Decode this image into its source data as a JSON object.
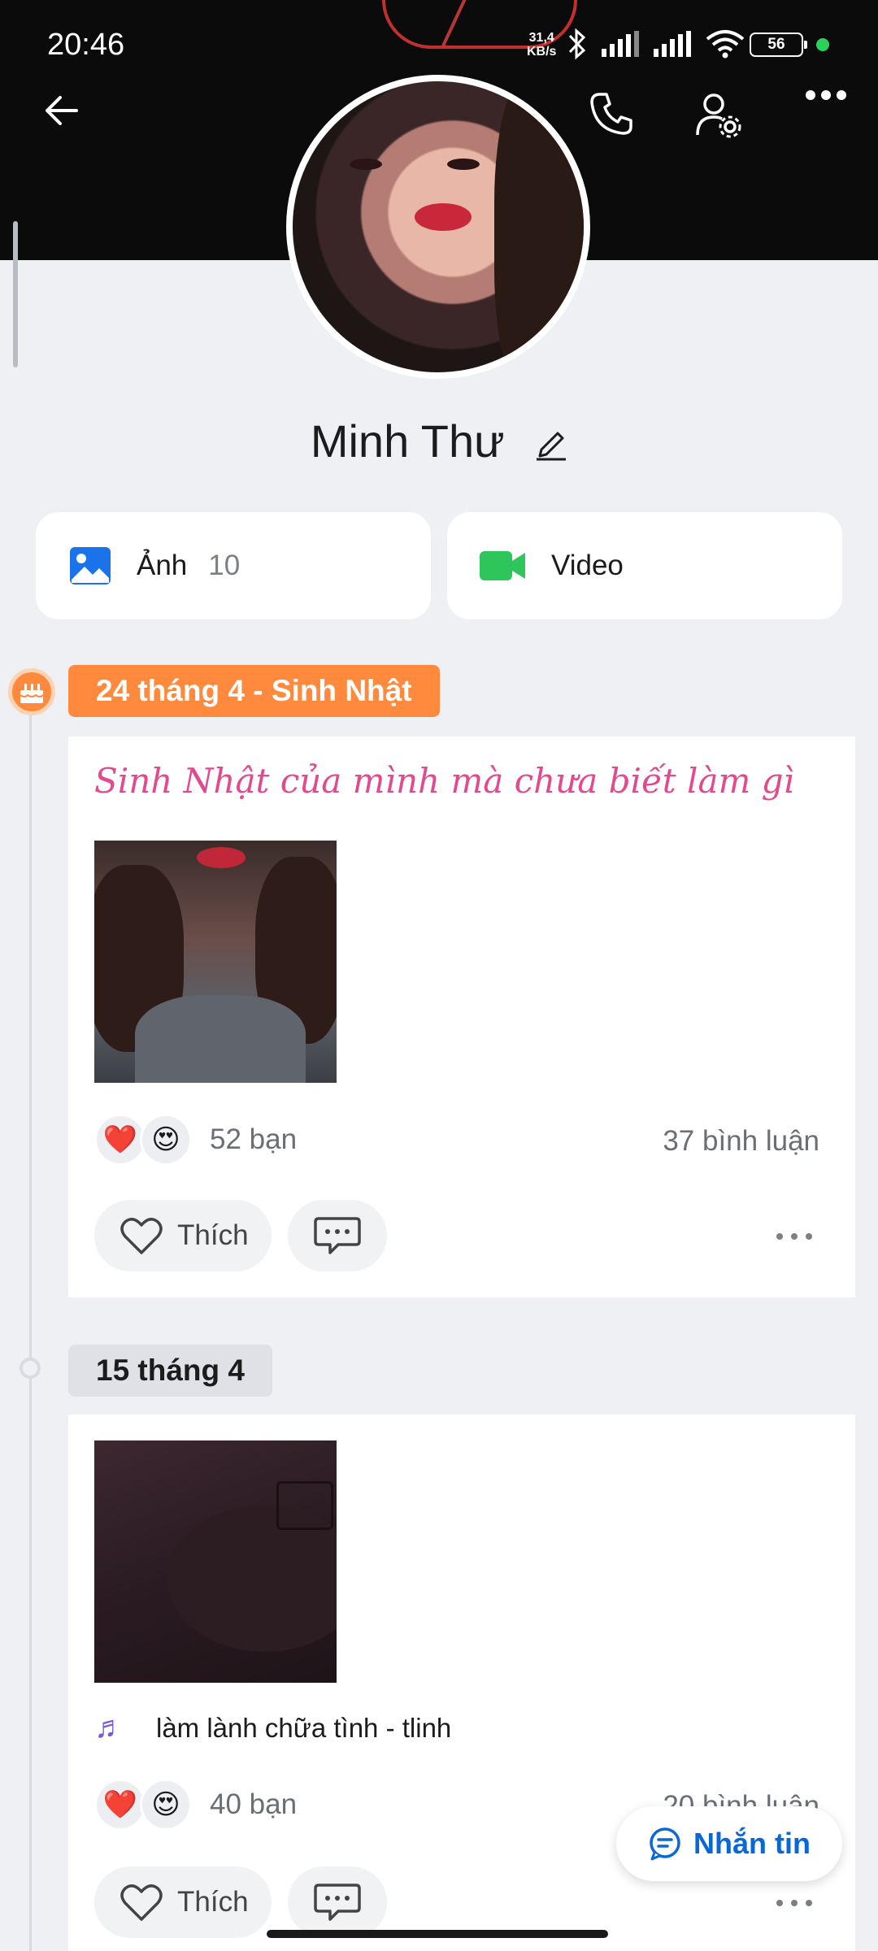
{
  "status_bar": {
    "time": "20:46",
    "speed_value": "31,4",
    "speed_unit": "KB/s",
    "battery": "56",
    "icons": [
      "bluetooth-icon",
      "signal-icon",
      "signal-icon",
      "wifi-icon"
    ]
  },
  "profile": {
    "name": "Minh Thư"
  },
  "media": {
    "photos_label": "Ảnh",
    "photos_count": "10",
    "video_label": "Video"
  },
  "posts": [
    {
      "date": "24 tháng 4 - Sinh Nhật",
      "text": "Sinh Nhật của mình mà chưa biết làm gì",
      "reactions": "52 bạn",
      "comments": "37 bình luận",
      "like_label": "Thích"
    },
    {
      "date": "15 tháng 4",
      "music": "làm lành chữa tình - tlinh",
      "reactions": "40 bạn",
      "comments": "20 bình luận",
      "like_label": "Thích"
    }
  ],
  "actions": {
    "message_label": "Nhắn tin"
  },
  "colors": {
    "accent_orange": "#ff8a3d",
    "status_pink": "#e24a8d",
    "message_blue": "#0a68d6"
  }
}
